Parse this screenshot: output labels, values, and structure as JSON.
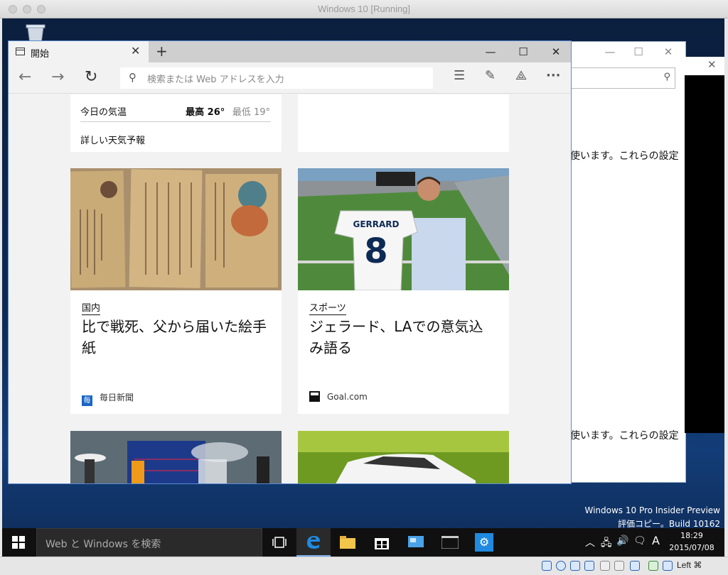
{
  "host_window": {
    "title": "Windows 10 [Running]"
  },
  "edge": {
    "tab_title": "開始",
    "address_placeholder": "検索または Web アドレスを入力"
  },
  "weather_card": {
    "label": "今日の気温",
    "high": "最高 26°",
    "low": "最低 19°",
    "link": "詳しい天気予報"
  },
  "news_cards": [
    {
      "category": "国内",
      "headline": "比で戦死、父から届いた絵手紙",
      "source": "毎日新聞"
    },
    {
      "category": "スポーツ",
      "headline": "ジェラード、LAでの意気込み語る",
      "source": "Goal.com",
      "jersey_name": "GERRARD",
      "jersey_number": "8"
    }
  ],
  "background_window": {
    "text_line_1": "使います。これらの設定",
    "text_line_2": "使います。これらの設定"
  },
  "watermark": {
    "line1": "Windows 10 Pro Insider Preview",
    "line2": "評価コピー。Build 10162"
  },
  "taskbar": {
    "search_placeholder": "Web と Windows を検索",
    "input_indicator": "A",
    "time": "18:29",
    "date": "2015/07/08"
  },
  "vbox_status": {
    "host_key": "Left ⌘"
  },
  "colors": {
    "edge_accent": "#0078d7",
    "taskbar_bg": "#101010",
    "window_border": "#5b8bd0"
  }
}
